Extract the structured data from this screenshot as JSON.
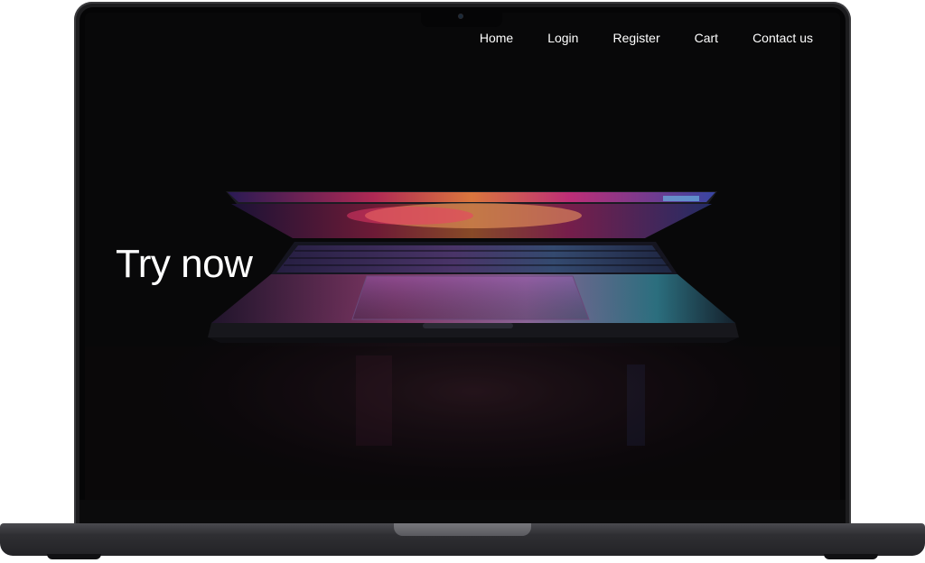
{
  "nav": {
    "items": [
      {
        "label": "Home"
      },
      {
        "label": "Login"
      },
      {
        "label": "Register"
      },
      {
        "label": "Cart"
      },
      {
        "label": "Contact us"
      }
    ]
  },
  "hero": {
    "title": "Try now",
    "image_icon": "laptop-photo"
  },
  "colors": {
    "screen_background": "#080809",
    "text": "#ffffff",
    "device_frame": "#1c1c1e"
  }
}
